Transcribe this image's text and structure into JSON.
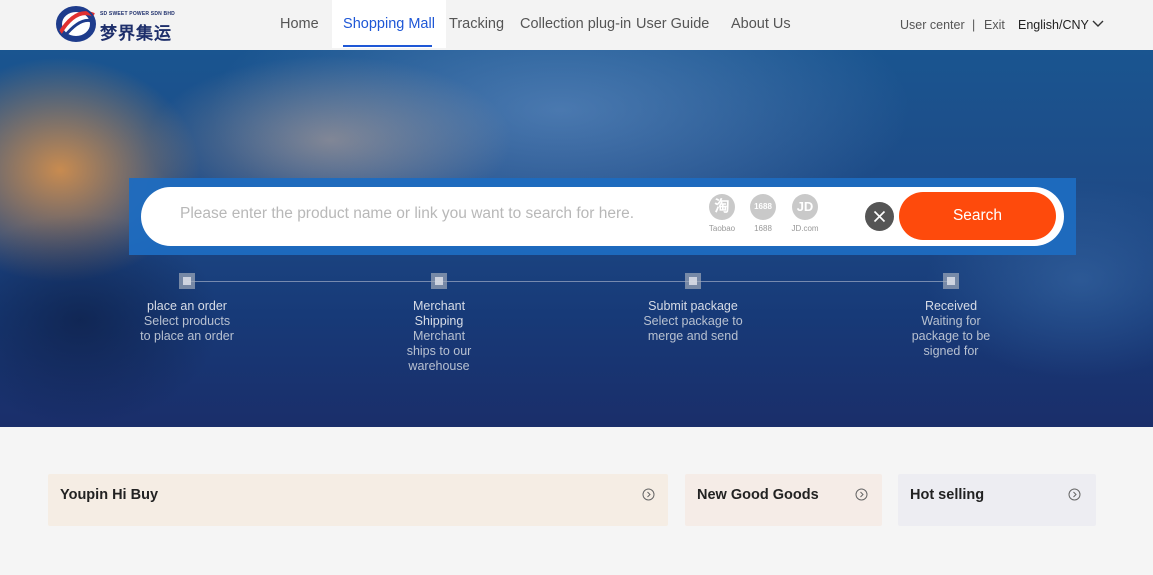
{
  "brand": {
    "sub": "SD SWEET POWER SDN BHD",
    "name": "梦界集运"
  },
  "nav": {
    "items": [
      {
        "label": "Home"
      },
      {
        "label": "Shopping Mall"
      },
      {
        "label": "Tracking"
      },
      {
        "label": "Collection plug-in"
      },
      {
        "label": "User Guide"
      },
      {
        "label": "About Us"
      }
    ],
    "active": "Shopping Mall"
  },
  "header": {
    "user_center": "User center",
    "separator": "|",
    "exit": "Exit",
    "language": "English/CNY"
  },
  "search": {
    "placeholder": "Please enter the product name or link you want to search for here.",
    "button": "Search",
    "platforms": [
      {
        "icon": "淘",
        "label": "Taobao"
      },
      {
        "icon": "1688",
        "label": "1688"
      },
      {
        "icon": "JD",
        "label": "JD.com"
      }
    ]
  },
  "steps": [
    {
      "title": "place an order",
      "desc": "Select products to place an order"
    },
    {
      "title": "Merchant Shipping",
      "desc": "Merchant ships to our warehouse"
    },
    {
      "title": "Submit package",
      "desc": "Select package to merge and send"
    },
    {
      "title": "Received",
      "desc": "Waiting for package to be signed for"
    }
  ],
  "categories": [
    {
      "label": "Youpin Hi Buy",
      "color": "#f5ede4"
    },
    {
      "label": "New Good Goods",
      "color": "#f5ece7"
    },
    {
      "label": "Hot selling",
      "color": "#ededf2"
    }
  ],
  "colors": {
    "accent": "#1e57d6",
    "search_button": "#fe4a0c",
    "brand": "#1e2f6b"
  }
}
